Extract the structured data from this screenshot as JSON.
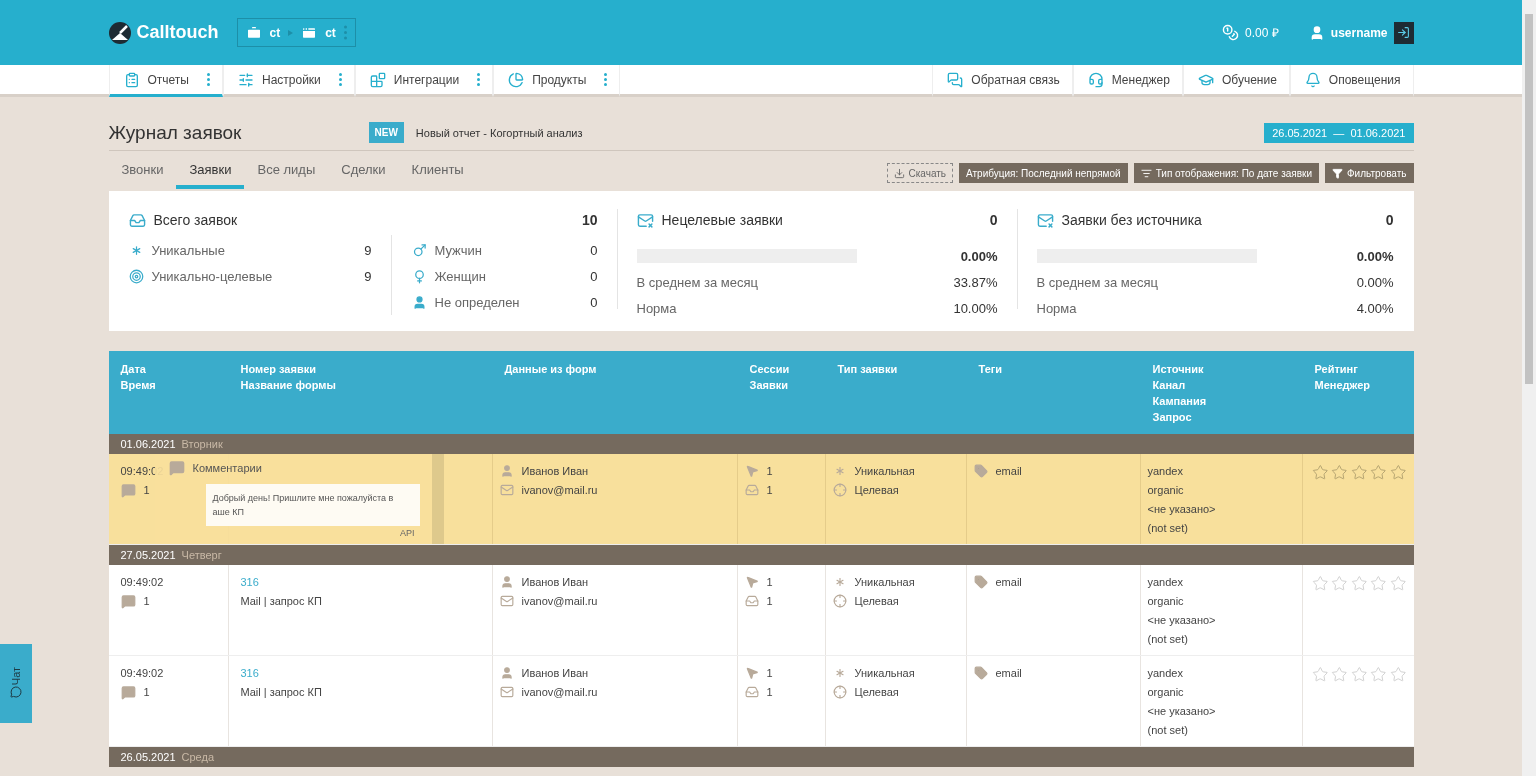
{
  "header": {
    "logo": "Calltouch",
    "account": "ct",
    "project": "ct",
    "balance": "0.00 ₽",
    "user": "username"
  },
  "nav_left": [
    {
      "label": "Отчеты",
      "selected": true
    },
    {
      "label": "Настройки",
      "selected": false
    },
    {
      "label": "Интеграции",
      "selected": false
    },
    {
      "label": "Продукты",
      "selected": false
    }
  ],
  "nav_right": [
    {
      "label": "Обратная связь"
    },
    {
      "label": "Менеджер"
    },
    {
      "label": "Обучение"
    },
    {
      "label": "Оповещения"
    }
  ],
  "page": {
    "title": "Журнал заявок",
    "badge": "NEW",
    "announcement": "Новый отчет - Когортный анализ",
    "date_range": "26.05.2021  —  01.06.2021"
  },
  "tabs": [
    {
      "label": "Звонки",
      "selected": false
    },
    {
      "label": "Заявки",
      "selected": true
    },
    {
      "label": "Все лиды",
      "selected": false
    },
    {
      "label": "Сделки",
      "selected": false
    },
    {
      "label": "Клиенты",
      "selected": false
    }
  ],
  "toolbar": {
    "download": "Скачать",
    "attribution": "Атрибуция: Последний непрямой",
    "display_type": "Тип отображения: По дате заявки",
    "filter": "Фильтровать"
  },
  "stats": {
    "total": {
      "title": "Всего заявок",
      "value": "10",
      "left": [
        {
          "label": "Уникальные",
          "value": "9"
        },
        {
          "label": "Уникально-целевые",
          "value": "9"
        }
      ],
      "right": [
        {
          "label": "Мужчин",
          "value": "0"
        },
        {
          "label": "Женщин",
          "value": "0"
        },
        {
          "label": "Не определен",
          "value": "0"
        }
      ]
    },
    "cards": [
      {
        "title": "Нецелевые заявки",
        "value": "0",
        "level": 0,
        "percent": "0.00%",
        "avg_label": "В среднем за месяц",
        "avg": "33.87%",
        "norm_label": "Норма",
        "norm": "10.00%"
      },
      {
        "title": "Заявки без источника",
        "value": "0",
        "level": 0,
        "percent": "0.00%",
        "avg_label": "В среднем за месяц",
        "avg": "0.00%",
        "norm_label": "Норма",
        "norm": "4.00%"
      }
    ]
  },
  "table": {
    "columns": [
      [
        "Дата",
        "Время"
      ],
      [
        "Номер заявки",
        "Название формы"
      ],
      [
        "Данные из форм"
      ],
      [
        "Сессии",
        "Заявки"
      ],
      [
        "Тип заявки"
      ],
      [
        "Теги"
      ],
      [
        "Источник",
        "Канал",
        "Кампания",
        "Запрос"
      ],
      [
        "Рейтинг",
        "Менеджер"
      ]
    ],
    "groups": [
      {
        "date": "01.06.2021",
        "weekday": "Вторник",
        "rows": [
          {
            "highlighted": true,
            "time": "09:49:02",
            "comments": "1",
            "name": "Иванов Иван",
            "email": "ivanov@mail.ru",
            "sessions": "1",
            "requests": "1",
            "type_unique": "Уникальная",
            "type_target": "Целевая",
            "tag": "email",
            "source": "yandex",
            "channel": "organic",
            "campaign": "<не указано>",
            "query": "(not set)",
            "stars": 0
          }
        ]
      },
      {
        "date": "27.05.2021",
        "weekday": "Четверг",
        "rows": [
          {
            "highlighted": false,
            "time": "09:49:02",
            "comments": "1",
            "number": "316",
            "form": "Mail | запрос КП",
            "name": "Иванов Иван",
            "email": "ivanov@mail.ru",
            "sessions": "1",
            "requests": "1",
            "type_unique": "Уникальная",
            "type_target": "Целевая",
            "tag": "email",
            "source": "yandex",
            "channel": "organic",
            "campaign": "<не указано>",
            "query": "(not set)",
            "stars": 0
          },
          {
            "highlighted": false,
            "time": "09:49:02",
            "comments": "1",
            "number": "316",
            "form": "Mail | запрос КП",
            "name": "Иванов Иван",
            "email": "ivanov@mail.ru",
            "sessions": "1",
            "requests": "1",
            "type_unique": "Уникальная",
            "type_target": "Целевая",
            "tag": "email",
            "source": "yandex",
            "channel": "organic",
            "campaign": "<не указано>",
            "query": "(not set)",
            "stars": 0
          }
        ]
      },
      {
        "date": "26.05.2021",
        "weekday": "Среда"
      }
    ]
  },
  "comment_popup": {
    "title": "Комментарии",
    "text": "Добрый день! Пришлите мне пожалуйста в аше КП",
    "source": "API"
  },
  "chat": {
    "label": "Чат"
  }
}
